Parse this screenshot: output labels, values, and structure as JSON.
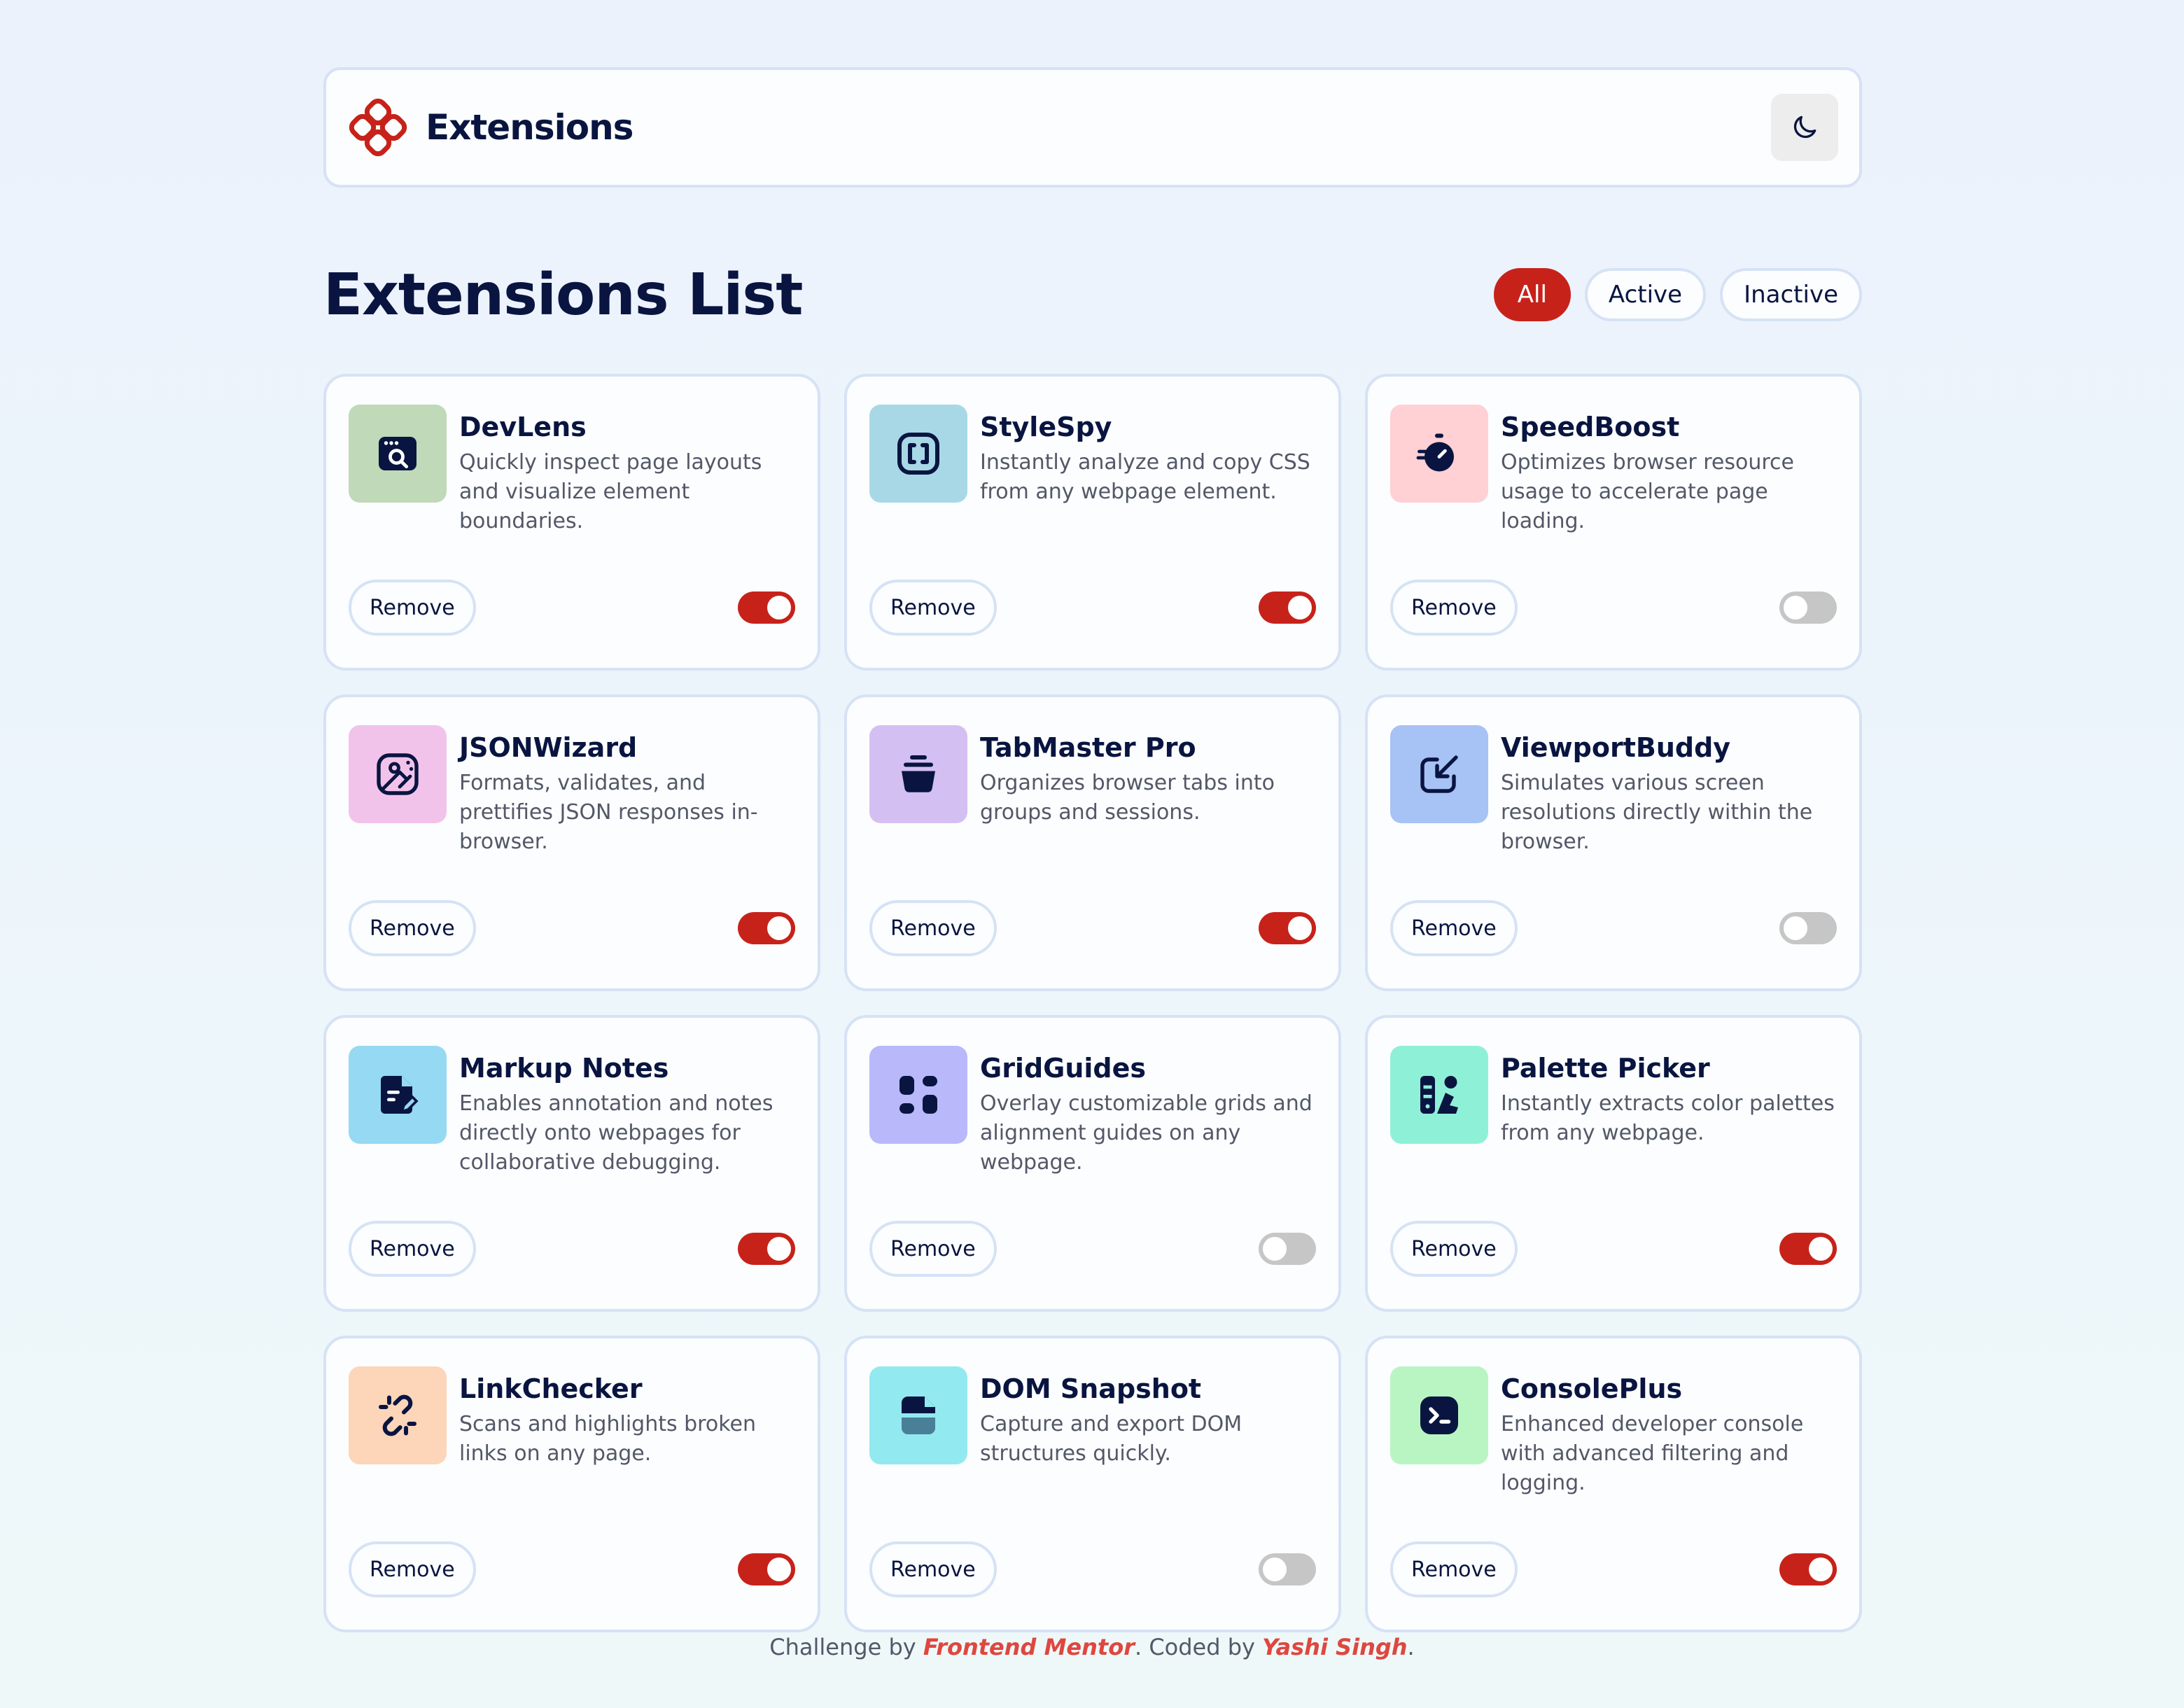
{
  "header": {
    "app_name": "Extensions",
    "theme_toggle_icon": "moon-icon"
  },
  "main": {
    "title": "Extensions List",
    "filters": [
      {
        "label": "All",
        "active": true
      },
      {
        "label": "Active",
        "active": false
      },
      {
        "label": "Inactive",
        "active": false
      }
    ]
  },
  "extensions": [
    {
      "name": "DevLens",
      "description": "Quickly inspect page layouts and visualize element boundaries.",
      "enabled": true,
      "icon": "devlens-icon",
      "icon_bg": "#c0d9b8",
      "remove_label": "Remove"
    },
    {
      "name": "StyleSpy",
      "description": "Instantly analyze and copy CSS from any webpage element.",
      "enabled": true,
      "icon": "stylespy-icon",
      "icon_bg": "#a8d8e6",
      "remove_label": "Remove"
    },
    {
      "name": "SpeedBoost",
      "description": "Optimizes browser resource usage to accelerate page loading.",
      "enabled": false,
      "icon": "speedboost-icon",
      "icon_bg": "#ffd0d4",
      "remove_label": "Remove"
    },
    {
      "name": "JSONWizard",
      "description": "Formats, validates, and prettifies JSON responses in-browser.",
      "enabled": true,
      "icon": "jsonwizard-icon",
      "icon_bg": "#f2c3ea",
      "remove_label": "Remove"
    },
    {
      "name": "TabMaster Pro",
      "description": "Organizes browser tabs into groups and sessions.",
      "enabled": true,
      "icon": "tabmaster-icon",
      "icon_bg": "#d4bff2",
      "remove_label": "Remove"
    },
    {
      "name": "ViewportBuddy",
      "description": "Simulates various screen resolutions directly within the browser.",
      "enabled": false,
      "icon": "viewportbuddy-icon",
      "icon_bg": "#a7c2f5",
      "remove_label": "Remove"
    },
    {
      "name": "Markup Notes",
      "description": "Enables annotation and notes directly onto webpages for collaborative debugging.",
      "enabled": true,
      "icon": "markupnotes-icon",
      "icon_bg": "#96d9f2",
      "remove_label": "Remove"
    },
    {
      "name": "GridGuides",
      "description": "Overlay customizable grids and alignment guides on any webpage.",
      "enabled": false,
      "icon": "gridguides-icon",
      "icon_bg": "#b9b8fa",
      "remove_label": "Remove"
    },
    {
      "name": "Palette Picker",
      "description": "Instantly extracts color palettes from any webpage.",
      "enabled": true,
      "icon": "palettepicker-icon",
      "icon_bg": "#8ff0d8",
      "remove_label": "Remove"
    },
    {
      "name": "LinkChecker",
      "description": "Scans and highlights broken links on any page.",
      "enabled": true,
      "icon": "linkchecker-icon",
      "icon_bg": "#fdd5b9",
      "remove_label": "Remove"
    },
    {
      "name": "DOM Snapshot",
      "description": "Capture and export DOM structures quickly.",
      "enabled": false,
      "icon": "domsnapshot-icon",
      "icon_bg": "#93e9f0",
      "remove_label": "Remove"
    },
    {
      "name": "ConsolePlus",
      "description": "Enhanced developer console with advanced filtering and logging.",
      "enabled": true,
      "icon": "consoleplus-icon",
      "icon_bg": "#b8f5c2",
      "remove_label": "Remove"
    }
  ],
  "footer": {
    "prefix": "Challenge by ",
    "org": "Frontend Mentor",
    "middle": ". Coded by ",
    "author": "Yashi Singh",
    "suffix": "."
  },
  "colors": {
    "accent": "#c7221a",
    "navy": "#091540",
    "toggle_off": "#c6c6c6"
  }
}
